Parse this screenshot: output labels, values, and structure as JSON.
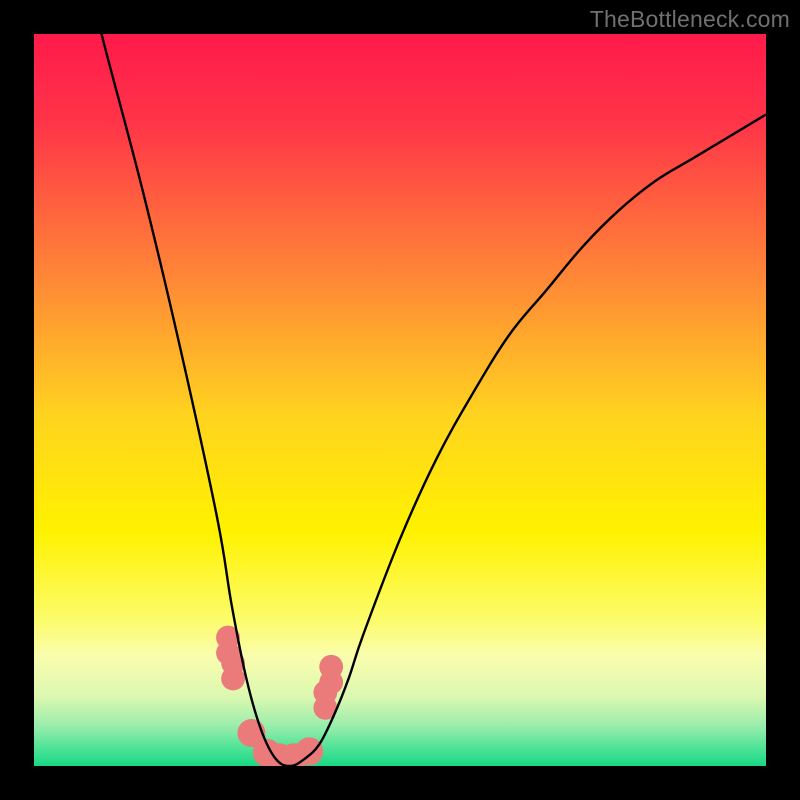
{
  "attribution": "TheBottleneck.com",
  "chart_data": {
    "type": "line",
    "title": "",
    "xlabel": "",
    "ylabel": "",
    "xlim": [
      0,
      100
    ],
    "ylim": [
      0,
      100
    ],
    "grid": false,
    "curve": {
      "description": "V-shaped bottleneck curve with minimum near x≈34",
      "x": [
        0,
        5,
        10,
        15,
        20,
        25,
        27,
        29,
        31,
        33,
        35,
        37,
        39,
        41,
        43,
        45,
        50,
        55,
        60,
        65,
        70,
        75,
        80,
        85,
        90,
        95,
        100
      ],
      "y": [
        130,
        116,
        97,
        78,
        57,
        34,
        22,
        12,
        5,
        1,
        0,
        1,
        3,
        7,
        12,
        18,
        31,
        42,
        51,
        59,
        65,
        71,
        76,
        80,
        83,
        86,
        89
      ]
    },
    "markers": {
      "x": [
        26.5,
        27.2,
        29.7,
        31.8,
        33.5,
        35.5,
        37.6,
        39.8,
        40.6
      ],
      "y": [
        16.5,
        13,
        4.5,
        1.8,
        1.2,
        1.2,
        2,
        9,
        12.5
      ],
      "color": "#eb7a7a",
      "size_main": 14,
      "size_pair_offset": 2
    },
    "gradient_stops": [
      {
        "offset": 0.0,
        "color": "#ff1a4b"
      },
      {
        "offset": 0.12,
        "color": "#ff3448"
      },
      {
        "offset": 0.34,
        "color": "#ff8a36"
      },
      {
        "offset": 0.52,
        "color": "#ffd31f"
      },
      {
        "offset": 0.68,
        "color": "#fff200"
      },
      {
        "offset": 0.8,
        "color": "#fcfc6b"
      },
      {
        "offset": 0.85,
        "color": "#fafdae"
      },
      {
        "offset": 0.905,
        "color": "#dcf8b0"
      },
      {
        "offset": 0.945,
        "color": "#9bedac"
      },
      {
        "offset": 0.975,
        "color": "#4fe398"
      },
      {
        "offset": 1.0,
        "color": "#18d884"
      }
    ]
  }
}
